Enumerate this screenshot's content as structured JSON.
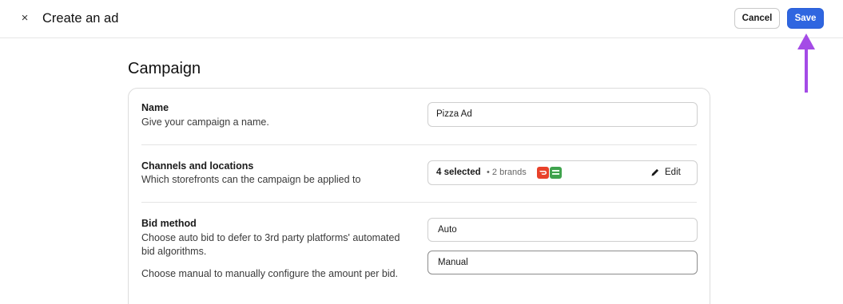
{
  "header": {
    "close_icon": "close-icon",
    "close_glyph": "×",
    "title": "Create an ad",
    "cancel_label": "Cancel",
    "save_label": "Save"
  },
  "annotation": {
    "arrow_color": "#a44be6",
    "icon": "arrow-up-icon"
  },
  "campaign": {
    "section_title": "Campaign",
    "name_row": {
      "label": "Name",
      "description": "Give your campaign a name.",
      "value": "Pizza Ad"
    },
    "channels_row": {
      "label": "Channels and locations",
      "description": "Which storefronts can the campaign be applied to",
      "selected_text": "4 selected",
      "brands_text": "• 2 brands",
      "brand_logos": [
        "doordash-logo",
        "ubereats-logo"
      ],
      "edit_label": "Edit",
      "edit_icon": "pencil-icon"
    },
    "bid_row": {
      "label": "Bid method",
      "description_1": "Choose auto bid to defer to 3rd party platforms' automated bid algorithms.",
      "description_2": "Choose manual to manually configure the amount per bid.",
      "options": [
        "Auto",
        "Manual"
      ]
    }
  },
  "colors": {
    "primary": "#2f66e0",
    "border": "#dcdcdc",
    "doordash": "#e8412a",
    "ubereats": "#3fa34d"
  }
}
